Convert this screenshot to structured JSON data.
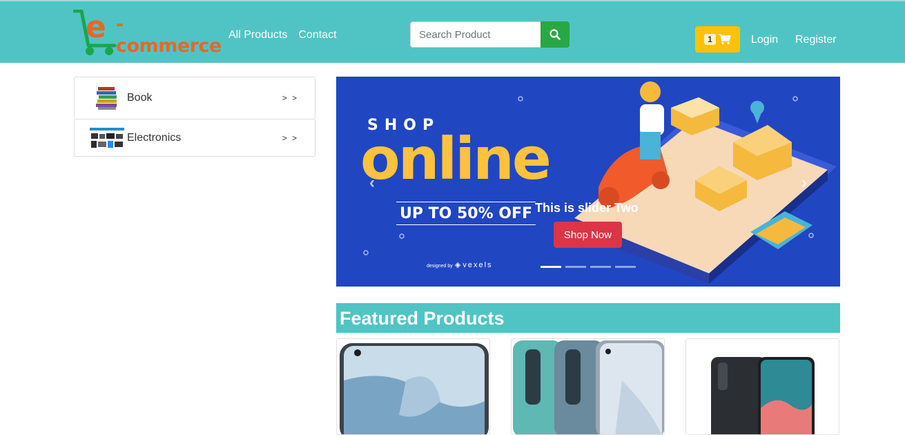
{
  "brand": {
    "logo_text": "e-commerce",
    "logo_letter": "e",
    "rest_text": "-commerce"
  },
  "nav": {
    "all_products": "All Products",
    "contact": "Contact"
  },
  "search": {
    "placeholder": "Search Product",
    "button_icon": "search-icon"
  },
  "cart": {
    "count": "1",
    "icon": "cart-icon"
  },
  "auth": {
    "login": "Login",
    "register": "Register"
  },
  "categories": [
    {
      "label": "Book",
      "arrow": "> >"
    },
    {
      "label": "Electronics",
      "arrow": "> >"
    }
  ],
  "slider": {
    "shop": "SHOP",
    "online": "online",
    "offer": "UP TO 50% OFF",
    "caption": "This is slider Two",
    "button": "Shop Now",
    "designed_by": "designed by",
    "vexels": "vexels",
    "active_slide": 1,
    "slide_count": 4
  },
  "featured": {
    "title": "Featured Products"
  },
  "colors": {
    "navbar": "#50c4c4",
    "cart": "#ffc107",
    "search_button": "#28a745",
    "shop_now": "#dc3545",
    "slider_bg": "#2046c2"
  }
}
